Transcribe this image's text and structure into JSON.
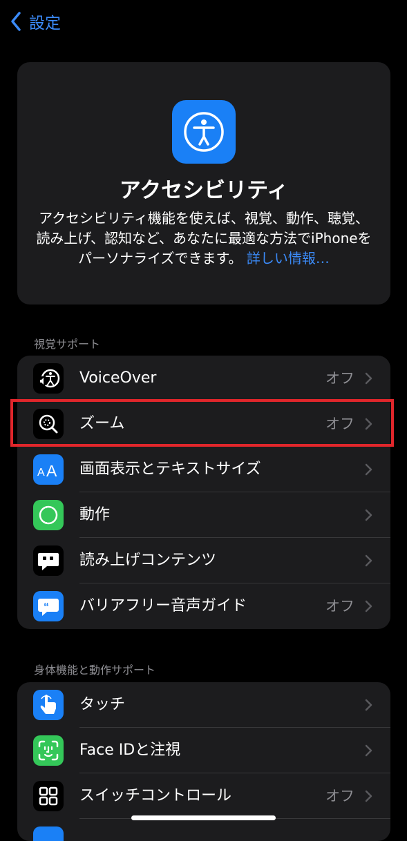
{
  "nav": {
    "back_label": "設定"
  },
  "hero": {
    "icon": "accessibility-icon",
    "title": "アクセシビリティ",
    "description_line1": "アクセシビリティ機能を使えば、視覚、動作、聴覚、",
    "description_line2": "読み上げ、認知など、あなたに最適な方法でiPhoneを",
    "description_line3": "パーソナライズできます。",
    "link": "詳しい情報…"
  },
  "vision": {
    "header": "視覚サポート",
    "items": [
      {
        "label": "VoiceOver",
        "value": "オフ",
        "icon": "voiceover-icon",
        "color": "#000000"
      },
      {
        "label": "ズーム",
        "value": "オフ",
        "icon": "zoom-icon",
        "color": "#000000"
      },
      {
        "label": "画面表示とテキストサイズ",
        "value": "",
        "icon": "text-size-icon",
        "color": "#1a80f6"
      },
      {
        "label": "動作",
        "value": "",
        "icon": "motion-icon",
        "color": "#34c759"
      },
      {
        "label": "読み上げコンテンツ",
        "value": "",
        "icon": "spoken-content-icon",
        "color": "#000000"
      },
      {
        "label": "バリアフリー音声ガイド",
        "value": "オフ",
        "icon": "audio-descriptions-icon",
        "color": "#1a80f6"
      }
    ]
  },
  "physical": {
    "header": "身体機能と動作サポート",
    "items": [
      {
        "label": "タッチ",
        "value": "",
        "icon": "touch-icon",
        "color": "#1a80f6"
      },
      {
        "label": "Face IDと注視",
        "value": "",
        "icon": "face-id-icon",
        "color": "#34c759"
      },
      {
        "label": "スイッチコントロール",
        "value": "オフ",
        "icon": "switch-control-icon",
        "color": "#000000"
      }
    ]
  },
  "colors": {
    "accent": "#3b8af7",
    "highlight": "#e0262b",
    "background": "#000000",
    "card": "#1c1c1e"
  }
}
